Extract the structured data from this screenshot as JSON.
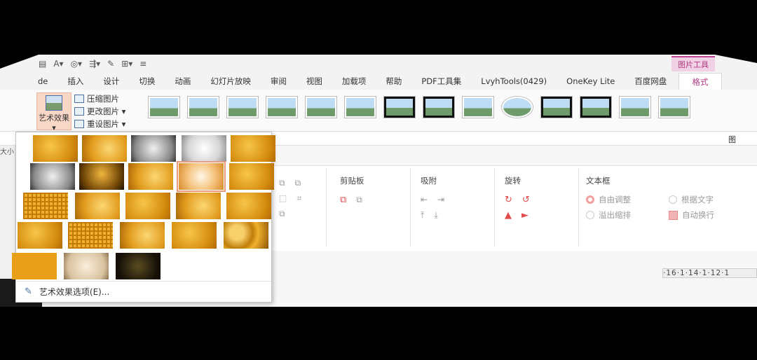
{
  "contextual_tab": "图片工具",
  "tabs": [
    "de",
    "插入",
    "设计",
    "切换",
    "动画",
    "幻灯片放映",
    "审阅",
    "视图",
    "加载项",
    "帮助",
    "PDF工具集",
    "LvyhTools(0429)",
    "OneKey Lite",
    "百度网盘"
  ],
  "active_tab": "格式",
  "art_effects_button": "艺术效果",
  "small_commands": [
    "压缩图片",
    "更改图片 ▾",
    "重设图片 ▾"
  ],
  "right_section_label": "图",
  "groups": {
    "clipboard": "剪贴板",
    "snap": "吸附",
    "rotate": "旋转",
    "textbox": "文本框"
  },
  "textbox_options": {
    "auto_adjust": "自由调整",
    "by_text": "根据文字",
    "overflow": "溢出缩排",
    "auto_wrap": "自动换行"
  },
  "ruler_text": "·16·1·14·1·12·1",
  "dropdown_footer": "艺术效果选项(E)...",
  "left_strip_label": "大小"
}
